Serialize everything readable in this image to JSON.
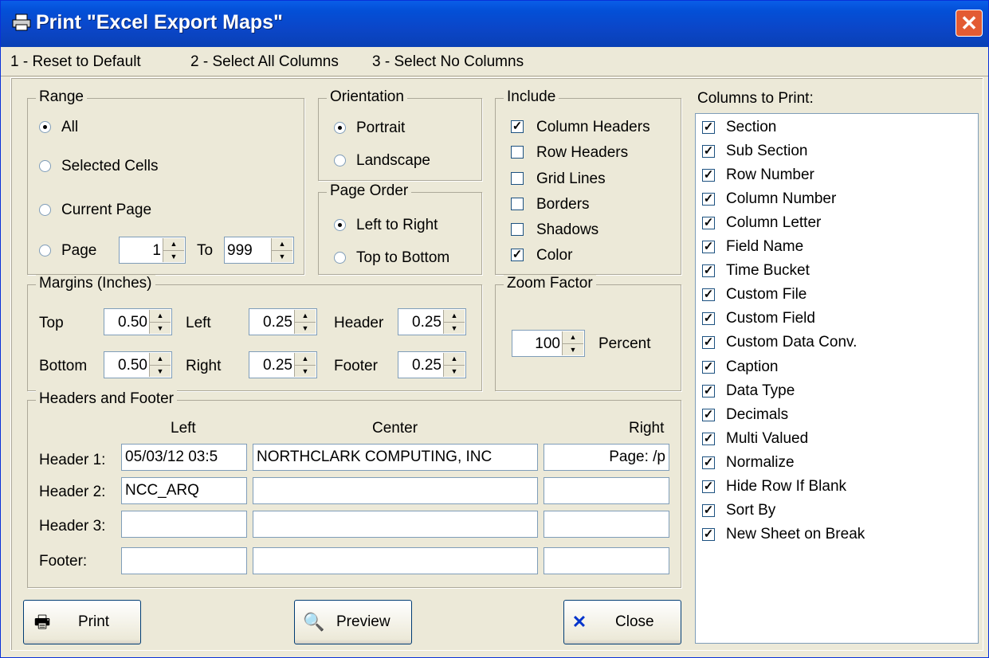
{
  "window": {
    "title": "Print \"Excel Export Maps\"",
    "icon": "printer-icon",
    "close_icon": "close-icon"
  },
  "menu": [
    "1 - Reset to Default",
    "2 - Select All Columns",
    "3 - Select No Columns"
  ],
  "range": {
    "legend": "Range",
    "options": [
      "All",
      "Selected Cells",
      "Current Page",
      "Page"
    ],
    "selected": "All",
    "page_from": "1",
    "to_label": "To",
    "page_to": "999"
  },
  "orientation": {
    "legend": "Orientation",
    "options": [
      "Portrait",
      "Landscape"
    ],
    "selected": "Portrait"
  },
  "page_order": {
    "legend": "Page Order",
    "options": [
      "Left to Right",
      "Top to Bottom"
    ],
    "selected": "Left to Right"
  },
  "include": {
    "legend": "Include",
    "items": [
      {
        "label": "Column Headers",
        "checked": true
      },
      {
        "label": "Row Headers",
        "checked": false
      },
      {
        "label": "Grid Lines",
        "checked": false
      },
      {
        "label": "Borders",
        "checked": false
      },
      {
        "label": "Shadows",
        "checked": false
      },
      {
        "label": "Color",
        "checked": true
      }
    ]
  },
  "margins": {
    "legend": "Margins (Inches)",
    "top_label": "Top",
    "top": "0.50",
    "left_label": "Left",
    "left": "0.25",
    "header_label": "Header",
    "header": "0.25",
    "bottom_label": "Bottom",
    "bottom": "0.50",
    "right_label": "Right",
    "right": "0.25",
    "footer_label": "Footer",
    "footer": "0.25"
  },
  "zoom": {
    "legend": "Zoom Factor",
    "value": "100",
    "unit": "Percent"
  },
  "headers_footer": {
    "legend": "Headers and Footer",
    "col_left": "Left",
    "col_center": "Center",
    "col_right": "Right",
    "rows": [
      {
        "label": "Header 1:",
        "left": "05/03/12  03:5",
        "center": "NORTHCLARK COMPUTING, INC",
        "right": "Page: /p"
      },
      {
        "label": "Header 2:",
        "left": "NCC_ARQ",
        "center": "",
        "right": ""
      },
      {
        "label": "Header 3:",
        "left": "",
        "center": "",
        "right": ""
      },
      {
        "label": "Footer:",
        "left": "",
        "center": "",
        "right": ""
      }
    ]
  },
  "columns": {
    "title": "Columns to Print:",
    "items": [
      "Section",
      "Sub Section",
      "Row Number",
      "Column Number",
      "Column Letter",
      "Field Name",
      "Time Bucket",
      "Custom File",
      "Custom Field",
      "Custom Data Conv.",
      "Caption",
      "Data Type",
      "Decimals",
      "Multi Valued",
      "Normalize",
      "Hide Row If Blank",
      "Sort By",
      "New Sheet on Break"
    ]
  },
  "buttons": {
    "print": "Print",
    "preview": "Preview",
    "close": "Close"
  },
  "colors": {
    "title_bar": "#0a5ee8",
    "close_button": "#e35b33",
    "dialog_bg": "#ece9d8"
  }
}
